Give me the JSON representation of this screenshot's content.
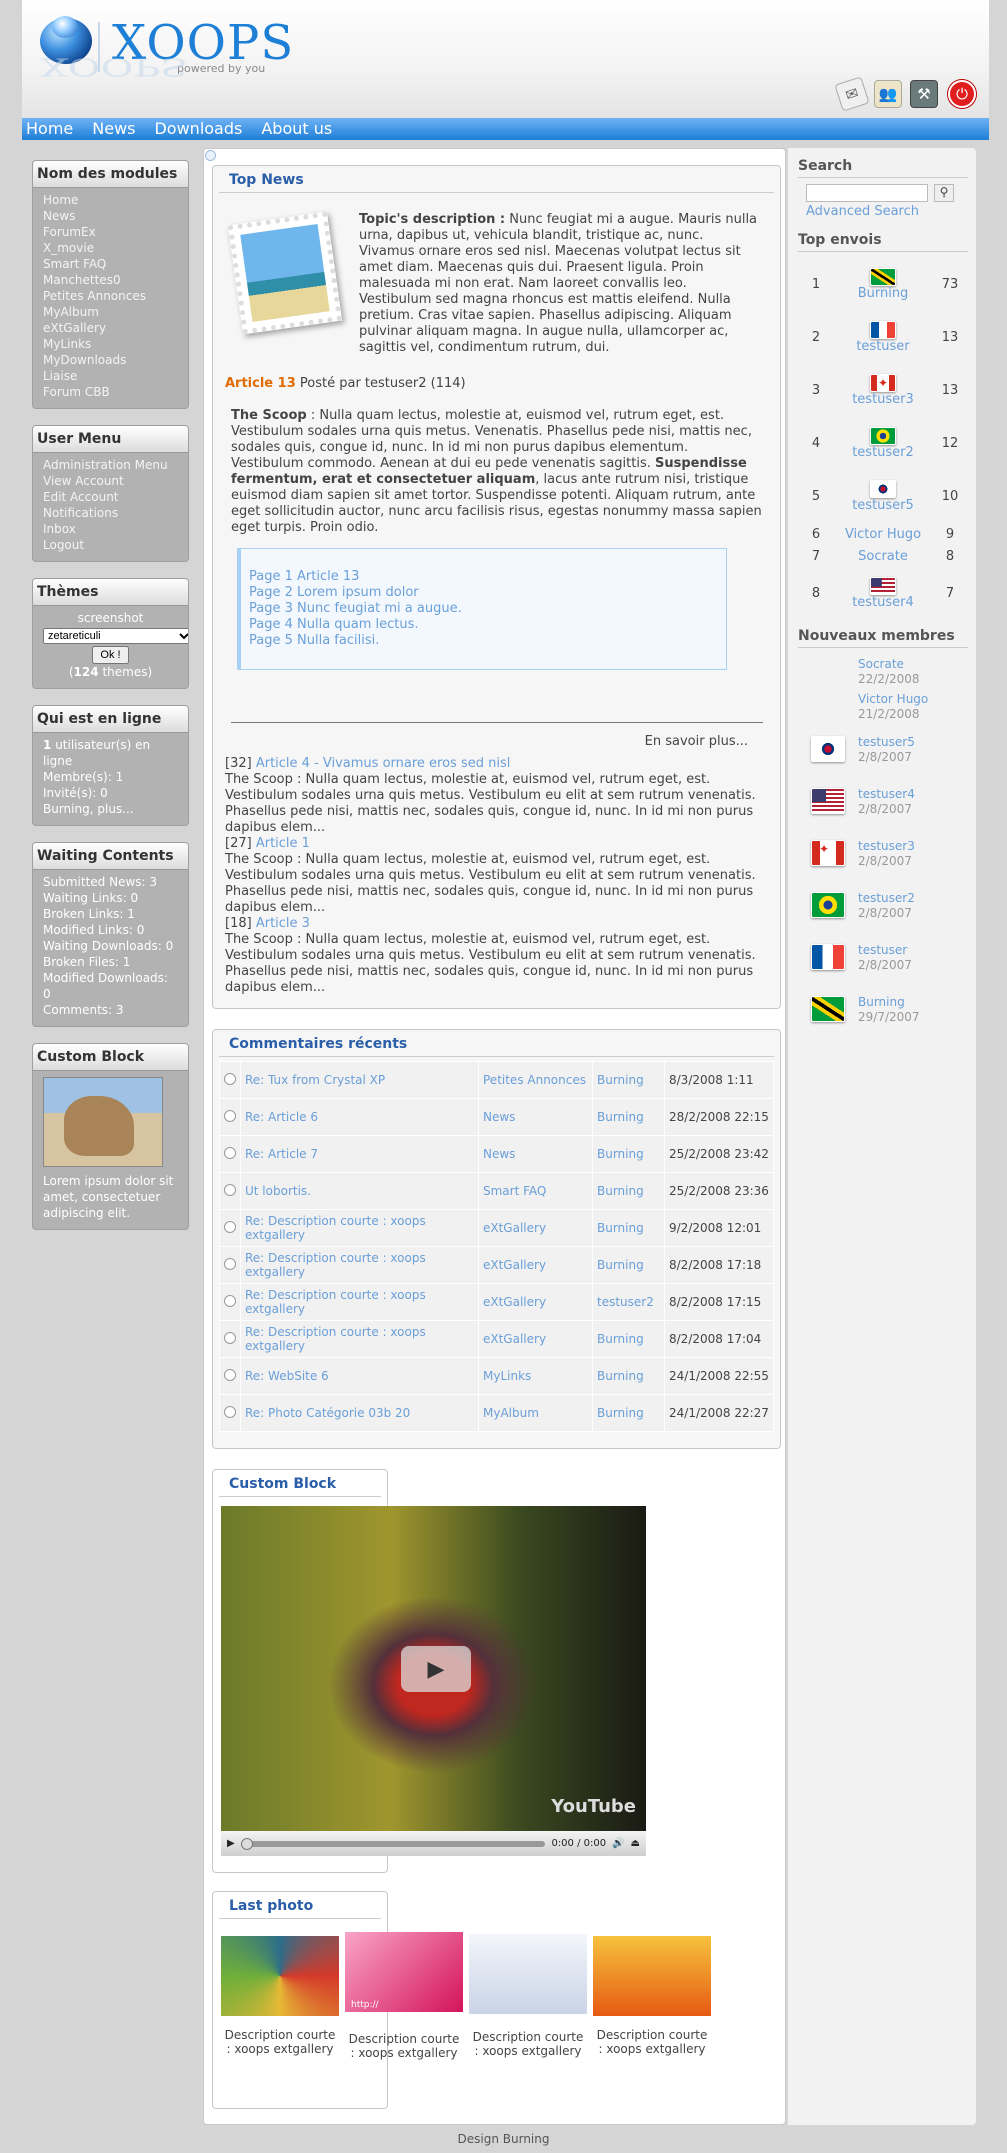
{
  "header": {
    "logo": "XOOPS",
    "tagline": "powered by you",
    "icons": [
      "mail-icon",
      "users-icon",
      "tools-icon",
      "power-icon"
    ]
  },
  "nav": [
    "Home",
    "News",
    "Downloads",
    "About us"
  ],
  "left": {
    "modules": {
      "title": "Nom des modules",
      "items": [
        "Home",
        "News",
        "ForumEx",
        "X_movie",
        "Smart FAQ",
        "Manchettes0",
        "Petites Annonces",
        "MyAlbum",
        "eXtGallery",
        "MyLinks",
        "MyDownloads",
        "Liaise",
        "Forum CBB"
      ]
    },
    "user_menu": {
      "title": "User Menu",
      "items": [
        "Administration Menu",
        "View Account",
        "Edit Account",
        "Notifications",
        "Inbox",
        "Logout"
      ]
    },
    "themes": {
      "title": "Thèmes",
      "label": "screenshot",
      "selected": "zetareticuli",
      "button": "Ok !",
      "count": "124",
      "count_suffix": "themes)",
      "count_prefix": "("
    },
    "online": {
      "title": "Qui est en ligne",
      "count": "1",
      "count_text": "utilisateur(s) en ligne",
      "members": "Membre(s): 1",
      "guests": "Invité(s): 0",
      "user": "Burning",
      "more": "plus..."
    },
    "waiting": {
      "title": "Waiting Contents",
      "items": [
        {
          "label": "Submitted News",
          "count": "3"
        },
        {
          "label": "Waiting Links",
          "count": "0"
        },
        {
          "label": "Broken Links",
          "count": "1"
        },
        {
          "label": "Modified Links",
          "count": "0"
        },
        {
          "label": "Waiting Downloads",
          "count": "0"
        },
        {
          "label": "Broken Files",
          "count": "1"
        },
        {
          "label": "Modified Downloads",
          "count": "0"
        },
        {
          "label": "Comments",
          "count": "3"
        }
      ]
    },
    "custom": {
      "title": "Custom Block",
      "text": "Lorem ipsum dolor sit amet, consectetuer adipiscing elit."
    }
  },
  "top_news": {
    "title": "Top News",
    "topic_label": "Topic's description :",
    "topic_text": "Nunc feugiat mi a augue. Mauris nulla urna, dapibus ut, vehicula blandit, tristique ac, nunc. Vivamus ornare eros sed nisl. Maecenas volutpat lectus sit amet diam. Maecenas quis dui. Praesent ligula. Proin malesuada mi non erat. Nam laoreet convallis leo. Vestibulum sed magna rhoncus est mattis eleifend. Nulla pretium. Cras vitae sapien. Phasellus adipiscing. Aliquam pulvinar aliquam magna. In augue nulla, ullamcorper ac, sagittis vel, condimentum rutrum, dui.",
    "article_title": "Article 13",
    "article_meta": "Posté par testuser2 (114)",
    "scoop_label": "The Scoop",
    "scoop_text": " : Nulla quam lectus, molestie at, euismod vel, rutrum eget, est. Vestibulum sodales urna quis metus. Venenatis. Phasellus pede nisi, mattis nec, sodales quis, congue id, nunc. In id mi non purus dapibus elementum. Vestibulum commodo. Aenean at dui eu pede venenatis sagittis. ",
    "scoop_bold": "Suspendisse fermentum, erat et consectetuer aliquam",
    "scoop_tail": ", lacus ante rutrum nisi, tristique euismod diam sapien sit amet tortor. Suspendisse potenti. Aliquam rutrum, ante eget sollicitudin auctor, nunc arcu facilisis risus, egestas nonummy massa sapien eget turpis. Proin odio.",
    "pages": [
      "Page 1 Article 13",
      "Page 2 Lorem ipsum dolor",
      "Page 3 Nunc feugiat mi a augue.",
      "Page 4 Nulla quam lectus.",
      "Page 5 Nulla facilisi."
    ],
    "read_more": "En savoir plus...",
    "others": [
      {
        "id": "[32]",
        "title": "Article 4 - Vivamus ornare eros sed nisl",
        "text": "The Scoop : Nulla quam lectus, molestie at, euismod vel, rutrum eget, est. Vestibulum sodales urna quis metus. Vestibulum eu elit at sem rutrum venenatis. Phasellus pede nisi, mattis nec, sodales quis, congue id, nunc. In id mi non purus dapibus elem..."
      },
      {
        "id": "[27]",
        "title": "Article 1",
        "text": "The Scoop : Nulla quam lectus, molestie at, euismod vel, rutrum eget, est. Vestibulum sodales urna quis metus. Vestibulum eu elit at sem rutrum venenatis. Phasellus pede nisi, mattis nec, sodales quis, congue id, nunc. In id mi non purus dapibus elem..."
      },
      {
        "id": "[18]",
        "title": "Article 3",
        "text": "The Scoop : Nulla quam lectus, molestie at, euismod vel, rutrum eget, est. Vestibulum sodales urna quis metus. Vestibulum eu elit at sem rutrum venenatis. Phasellus pede nisi, mattis nec, sodales quis, congue id, nunc. In id mi non purus dapibus elem..."
      }
    ]
  },
  "comments": {
    "title": "Commentaires récents",
    "rows": [
      {
        "title": "Re: Tux from Crystal XP",
        "module": "Petites Annonces",
        "user": "Burning",
        "date": "8/3/2008 1:11"
      },
      {
        "title": "Re: Article 6",
        "module": "News",
        "user": "Burning",
        "date": "28/2/2008 22:15"
      },
      {
        "title": "Re: Article 7",
        "module": "News",
        "user": "Burning",
        "date": "25/2/2008 23:42"
      },
      {
        "title": "Ut lobortis.",
        "module": "Smart FAQ",
        "user": "Burning",
        "date": "25/2/2008 23:36"
      },
      {
        "title": "Re: Description courte : xoops extgallery",
        "module": "eXtGallery",
        "user": "Burning",
        "date": "9/2/2008 12:01"
      },
      {
        "title": "Re: Description courte : xoops extgallery",
        "module": "eXtGallery",
        "user": "Burning",
        "date": "8/2/2008 17:18"
      },
      {
        "title": "Re: Description courte : xoops extgallery",
        "module": "eXtGallery",
        "user": "testuser2",
        "date": "8/2/2008 17:15"
      },
      {
        "title": "Re: Description courte : xoops extgallery",
        "module": "eXtGallery",
        "user": "Burning",
        "date": "8/2/2008 17:04"
      },
      {
        "title": "Re: WebSite 6",
        "module": "MyLinks",
        "user": "Burning",
        "date": "24/1/2008 22:55"
      },
      {
        "title": "Re: Photo Catégorie 03b 20",
        "module": "MyAlbum",
        "user": "Burning",
        "date": "24/1/2008 22:27"
      }
    ]
  },
  "video": {
    "title": "Custom Block",
    "time": "0:00 / 0:00",
    "brand": "YouTube"
  },
  "last_photo": {
    "title": "Last photo",
    "captions": [
      "Description courte : xoops extgallery",
      "Description courte : xoops extgallery",
      "Description courte : xoops extgallery",
      "Description courte : xoops extgallery"
    ],
    "url_overlay": "http://"
  },
  "right": {
    "search": {
      "title": "Search",
      "advanced": "Advanced Search"
    },
    "top_posters": {
      "title": "Top envois",
      "rows": [
        {
          "rank": "1",
          "name": "Burning",
          "count": "73",
          "flag": "jamaica"
        },
        {
          "rank": "2",
          "name": "testuser",
          "count": "13",
          "flag": "france"
        },
        {
          "rank": "3",
          "name": "testuser3",
          "count": "13",
          "flag": "canada"
        },
        {
          "rank": "4",
          "name": "testuser2",
          "count": "12",
          "flag": "brazil"
        },
        {
          "rank": "5",
          "name": "testuser5",
          "count": "10",
          "flag": "korea"
        },
        {
          "rank": "6",
          "name": "Victor Hugo",
          "count": "9",
          "flag": ""
        },
        {
          "rank": "7",
          "name": "Socrate",
          "count": "8",
          "flag": ""
        },
        {
          "rank": "8",
          "name": "testuser4",
          "count": "7",
          "flag": "usa"
        }
      ]
    },
    "new_members": {
      "title": "Nouveaux membres",
      "rows": [
        {
          "name": "Socrate",
          "date": "22/2/2008",
          "flag": ""
        },
        {
          "name": "Victor Hugo",
          "date": "21/2/2008",
          "flag": ""
        },
        {
          "name": "testuser5",
          "date": "2/8/2007",
          "flag": "korea"
        },
        {
          "name": "testuser4",
          "date": "2/8/2007",
          "flag": "usa"
        },
        {
          "name": "testuser3",
          "date": "2/8/2007",
          "flag": "canada"
        },
        {
          "name": "testuser2",
          "date": "2/8/2007",
          "flag": "brazil"
        },
        {
          "name": "testuser",
          "date": "2/8/2007",
          "flag": "france"
        },
        {
          "name": "Burning",
          "date": "29/7/2007",
          "flag": "jamaica"
        }
      ]
    }
  },
  "footer": "Design Burning"
}
